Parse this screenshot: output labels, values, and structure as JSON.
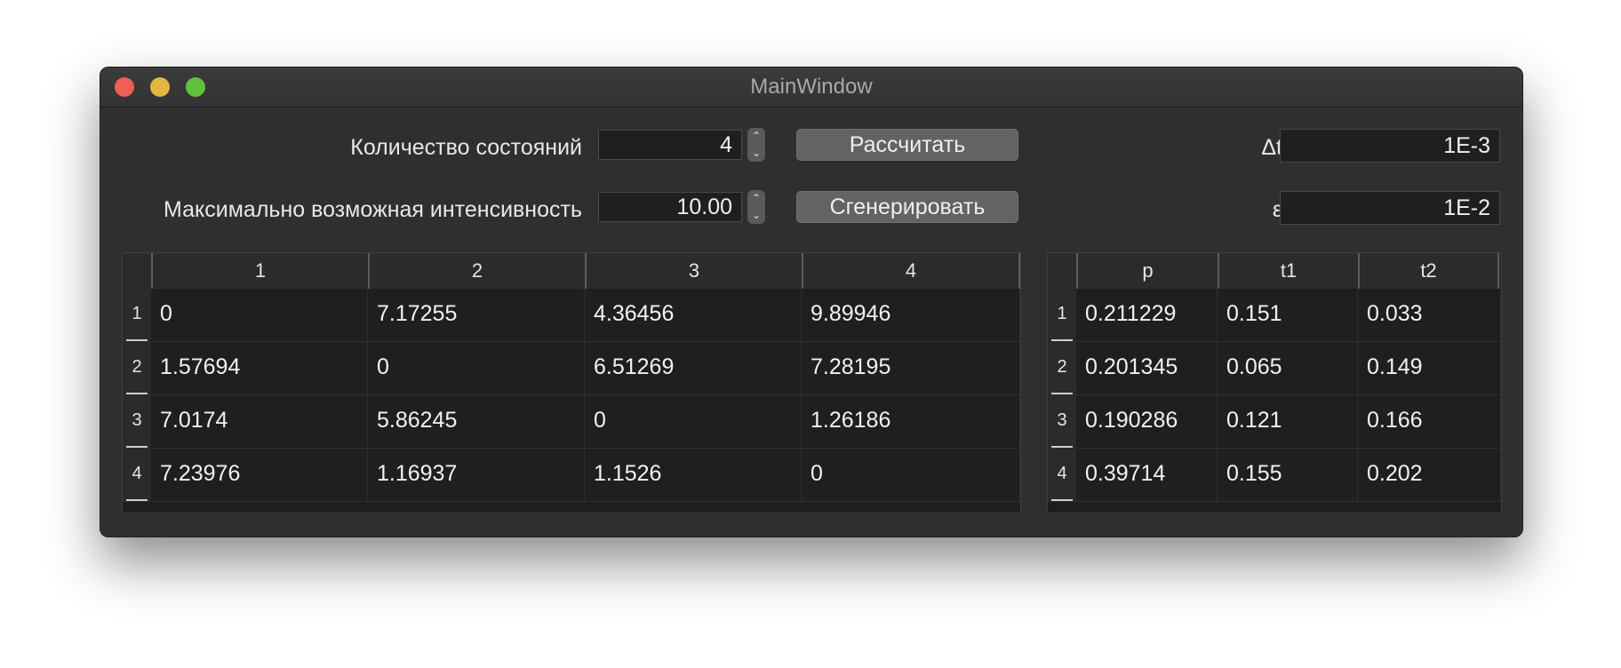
{
  "window": {
    "title": "MainWindow"
  },
  "controls": {
    "states_label": "Количество состояний",
    "states_value": "4",
    "intensity_label": "Максимально возможная интенсивность",
    "intensity_value": "10.00",
    "calculate_label": "Рассчитать",
    "generate_label": "Сгенерировать",
    "dt_label": "Δt",
    "dt_value": "1E-3",
    "eps_label": "ε",
    "eps_value": "1E-2"
  },
  "matrix": {
    "columns": [
      "1",
      "2",
      "3",
      "4"
    ],
    "row_headers": [
      "1",
      "2",
      "3",
      "4"
    ],
    "rows": [
      [
        "0",
        "7.17255",
        "4.36456",
        "9.89946"
      ],
      [
        "1.57694",
        "0",
        "6.51269",
        "7.28195"
      ],
      [
        "7.0174",
        "5.86245",
        "0",
        "1.26186"
      ],
      [
        "7.23976",
        "1.16937",
        "1.1526",
        "0"
      ]
    ]
  },
  "results": {
    "columns": [
      "p",
      "t1",
      "t2"
    ],
    "row_headers": [
      "1",
      "2",
      "3",
      "4"
    ],
    "rows": [
      [
        "0.211229",
        "0.151",
        "0.033"
      ],
      [
        "0.201345",
        "0.065",
        "0.149"
      ],
      [
        "0.190286",
        "0.121",
        "0.166"
      ],
      [
        "0.39714",
        "0.155",
        "0.202"
      ]
    ]
  }
}
